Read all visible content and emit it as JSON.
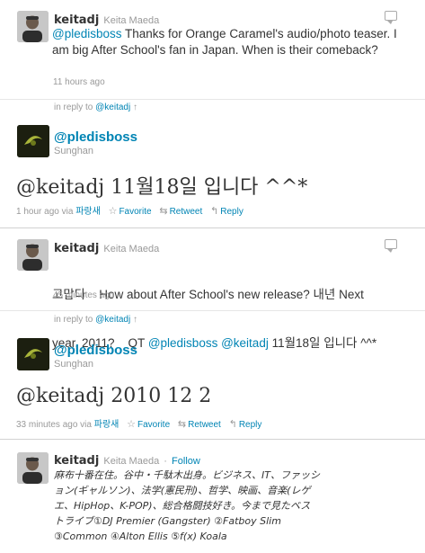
{
  "tweet1": {
    "username": "keitadj",
    "fullname": "Keita Maeda",
    "mention": "@pledisboss",
    "text": " Thanks for Orange Caramel's audio/photo teaser. I am big After School's fan in Japan. When is their comeback?",
    "time": "11 hours ago",
    "in_reply_prefix": "in reply to ",
    "in_reply_user": "@keitadj",
    "in_reply_arrow": "↑"
  },
  "tweet2": {
    "username": "@pledisboss",
    "subname": "Sunghan",
    "text": "@keitadj 11월18일 입니다 ^^*",
    "time": "1 hour ago",
    "via_prefix": "via",
    "via": "파랑새",
    "favorite": "Favorite",
    "retweet": "Retweet",
    "reply": "Reply"
  },
  "tweet3": {
    "username": "keitadj",
    "fullname": "Keita Maeda",
    "line1": "고맙다    How about After School's new release? 내년 Next",
    "line2_pre": "year, 2011?    QT ",
    "mention1": "@pledisboss",
    "mention2": "@keitadj",
    "line2_post": " 11월18일 입니다 ^^*",
    "time": "45 minutes ago",
    "in_reply_prefix": "in reply to ",
    "in_reply_user": "@keitadj",
    "in_reply_arrow": "↑"
  },
  "tweet4": {
    "username": "@pledisboss",
    "subname": "Sunghan",
    "text": "@keitadj 2010 12 2",
    "time": "33 minutes ago",
    "via_prefix": "via",
    "via": "파랑새",
    "favorite": "Favorite",
    "retweet": "Retweet",
    "reply": "Reply"
  },
  "profile": {
    "username": "keitadj",
    "fullname": "Keita Maeda",
    "separator": "·",
    "follow": "Follow",
    "bio_lines": [
      "麻布十番在住。谷中・千駄木出身。ビジネス、IT、ファッシ",
      "ョン(ギャルソン)、法学(憲民刑)、哲学、映画、音楽(レゲ",
      "エ、HipHop、K-POP)、総合格闘技好き。今まで見たベス",
      "トライブ①DJ Premier (Gangster) ②Fatboy Slim",
      "③Common ④Alton Ellis ⑤f(x) Koala"
    ]
  },
  "colors": {
    "link": "#0084b4",
    "muted": "#999999",
    "text": "#333333"
  },
  "icons": {
    "reply": "speech-bubble-icon",
    "favorite": "star-icon",
    "retweet": "retweet-icon",
    "reply_action": "reply-arrow-icon",
    "arrow_up": "arrow-up-icon"
  }
}
